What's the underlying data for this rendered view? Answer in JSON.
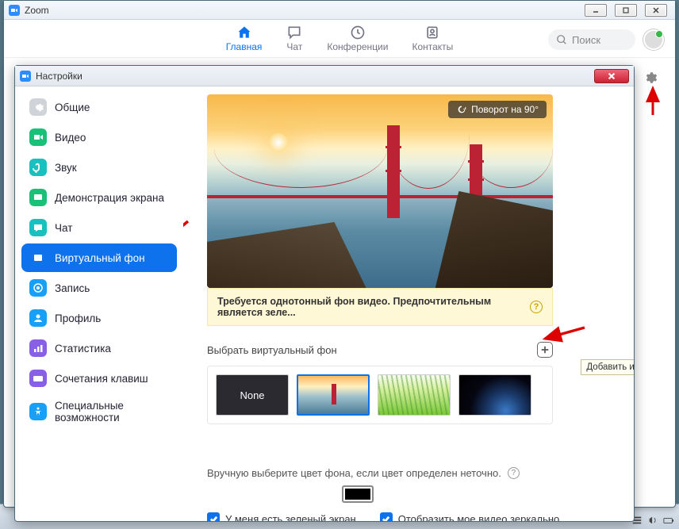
{
  "main_window": {
    "title": "Zoom",
    "nav": [
      {
        "label": "Главная",
        "icon": "home",
        "active": true
      },
      {
        "label": "Чат",
        "icon": "chat"
      },
      {
        "label": "Конференции",
        "icon": "clock"
      },
      {
        "label": "Контакты",
        "icon": "contacts"
      }
    ],
    "search_placeholder": "Поиск"
  },
  "settings_window": {
    "title": "Настройки",
    "sidebar": [
      {
        "label": "Общие",
        "color": "#d0d4d8",
        "icon": "gear"
      },
      {
        "label": "Видео",
        "color": "#18c078",
        "icon": "video"
      },
      {
        "label": "Звук",
        "color": "#18c0c0",
        "icon": "audio"
      },
      {
        "label": "Демонстрация экрана",
        "color": "#18c078",
        "icon": "screen"
      },
      {
        "label": "Чат",
        "color": "#18c0c0",
        "icon": "chat2"
      },
      {
        "label": "Виртуальный фон",
        "color": "#0e72ed",
        "icon": "vbg",
        "active": true
      },
      {
        "label": "Запись",
        "color": "#18a0f8",
        "icon": "record"
      },
      {
        "label": "Профиль",
        "color": "#18a0f8",
        "icon": "profile"
      },
      {
        "label": "Статистика",
        "color": "#8860e8",
        "icon": "stats"
      },
      {
        "label": "Сочетания клавиш",
        "color": "#8860e8",
        "icon": "keys"
      },
      {
        "label": "Специальные возможности",
        "color": "#18a0f8",
        "icon": "access"
      }
    ],
    "rotate_label": "Поворот на 90°",
    "warning_text": "Требуется однотонный фон видео. Предпочтительным является зеле...",
    "choose_label": "Выбрать виртуальный фон",
    "add_tooltip": "Добавить изображение",
    "thumb_none_label": "None",
    "manual_label": "Вручную выберите цвет фона, если цвет определен неточно.",
    "check1": "У меня есть зеленый экран",
    "check2": "Отобразить мое видео зеркально"
  }
}
